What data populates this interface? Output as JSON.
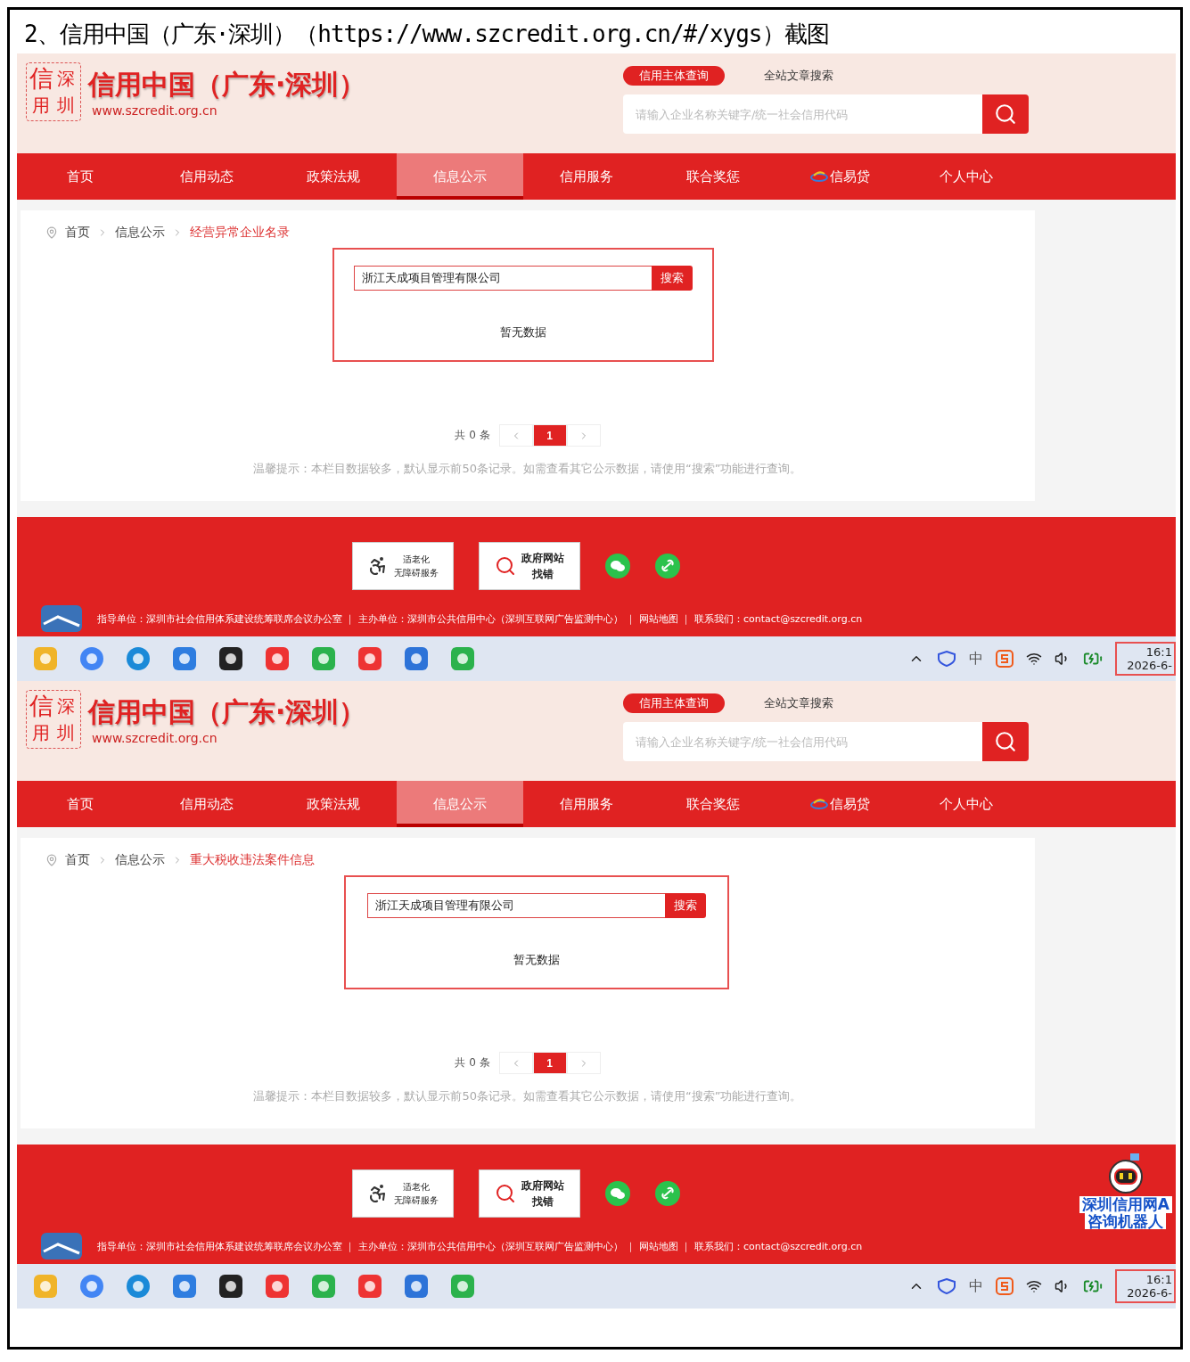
{
  "heading": "2、信用中国（广东·深圳）（https://www.szcredit.org.cn/#/xygs）截图",
  "screenshots": [
    {
      "logo": {
        "seal": [
          "信",
          "深",
          "用",
          "圳"
        ],
        "title": "信用中国（广东·深圳）",
        "url": "www.szcredit.org.cn"
      },
      "search_tabs": [
        {
          "label": "信用主体查询",
          "selected": true
        },
        {
          "label": "全站文章搜索",
          "selected": false
        }
      ],
      "site_search": {
        "placeholder": "请输入企业名称关键字/统一社会信用代码"
      },
      "nav": [
        {
          "label": "首页",
          "selected": false
        },
        {
          "label": "信用动态",
          "selected": false
        },
        {
          "label": "政策法规",
          "selected": false
        },
        {
          "label": "信息公示",
          "selected": true
        },
        {
          "label": "信用服务",
          "selected": false
        },
        {
          "label": "联合奖惩",
          "selected": false
        },
        {
          "label": "信易贷",
          "selected": false,
          "kind": "logo"
        },
        {
          "label": "个人中心",
          "selected": false
        }
      ],
      "breadcrumb": [
        {
          "label": "首页",
          "current": false
        },
        {
          "label": "信息公示",
          "current": false
        },
        {
          "label": "经营异常企业名录",
          "current": true
        }
      ],
      "query": {
        "value": "浙江天成项目管理有限公司",
        "button": "搜索",
        "empty": "暂无数据"
      },
      "pagination": {
        "total": "共 0 条",
        "pages": [
          {
            "label": "1",
            "selected": true
          }
        ]
      },
      "hint": "温馨提示：本栏目数据较多，默认显示前50条记录。如需查看其它公示数据，请使用“搜索”功能进行查询。",
      "footer": {
        "badges": [
          {
            "kind": "accessibility",
            "lines": [
              "适老化",
              "无障碍服务"
            ]
          },
          {
            "kind": "gov",
            "lines": [
              "政府网站",
              "找错"
            ]
          }
        ],
        "info": "指导单位：深圳市社会信用体系建设统筹联席会议办公室 ｜ 主办单位：深圳市公共信用中心（深圳互联网广告监测中心） ｜ 网站地图 ｜ 联系我们：contact@szcredit.org.cn"
      },
      "taskbar": {
        "ime": "中",
        "time": "16:1",
        "date": "2026-6-"
      }
    },
    {
      "logo": {
        "seal": [
          "信",
          "深",
          "用",
          "圳"
        ],
        "title": "信用中国（广东·深圳）",
        "url": "www.szcredit.org.cn"
      },
      "search_tabs": [
        {
          "label": "信用主体查询",
          "selected": true
        },
        {
          "label": "全站文章搜索",
          "selected": false
        }
      ],
      "site_search": {
        "placeholder": "请输入企业名称关键字/统一社会信用代码"
      },
      "nav": [
        {
          "label": "首页",
          "selected": false
        },
        {
          "label": "信用动态",
          "selected": false
        },
        {
          "label": "政策法规",
          "selected": false
        },
        {
          "label": "信息公示",
          "selected": true
        },
        {
          "label": "信用服务",
          "selected": false
        },
        {
          "label": "联合奖惩",
          "selected": false
        },
        {
          "label": "信易贷",
          "selected": false,
          "kind": "logo"
        },
        {
          "label": "个人中心",
          "selected": false
        }
      ],
      "breadcrumb": [
        {
          "label": "首页",
          "current": false
        },
        {
          "label": "信息公示",
          "current": false
        },
        {
          "label": "重大税收违法案件信息",
          "current": true
        }
      ],
      "query": {
        "value": "浙江天成项目管理有限公司",
        "button": "搜索",
        "empty": "暂无数据"
      },
      "pagination": {
        "total": "共 0 条",
        "pages": [
          {
            "label": "1",
            "selected": true
          }
        ]
      },
      "hint": "温馨提示：本栏目数据较多，默认显示前50条记录。如需查看其它公示数据，请使用“搜索”功能进行查询。",
      "footer": {
        "badges": [
          {
            "kind": "accessibility",
            "lines": [
              "适老化",
              "无障碍服务"
            ]
          },
          {
            "kind": "gov",
            "lines": [
              "政府网站",
              "找错"
            ]
          }
        ],
        "info": "指导单位：深圳市社会信用体系建设统筹联席会议办公室 ｜ 主办单位：深圳市公共信用中心（深圳互联网广告监测中心） ｜ 网站地图 ｜ 联系我们：contact@szcredit.org.cn"
      },
      "assistant": {
        "lines": [
          "深圳信用网A",
          "咨询机器人"
        ]
      },
      "taskbar": {
        "ime": "中",
        "time": "16:1",
        "date": "2026-6-"
      }
    }
  ]
}
